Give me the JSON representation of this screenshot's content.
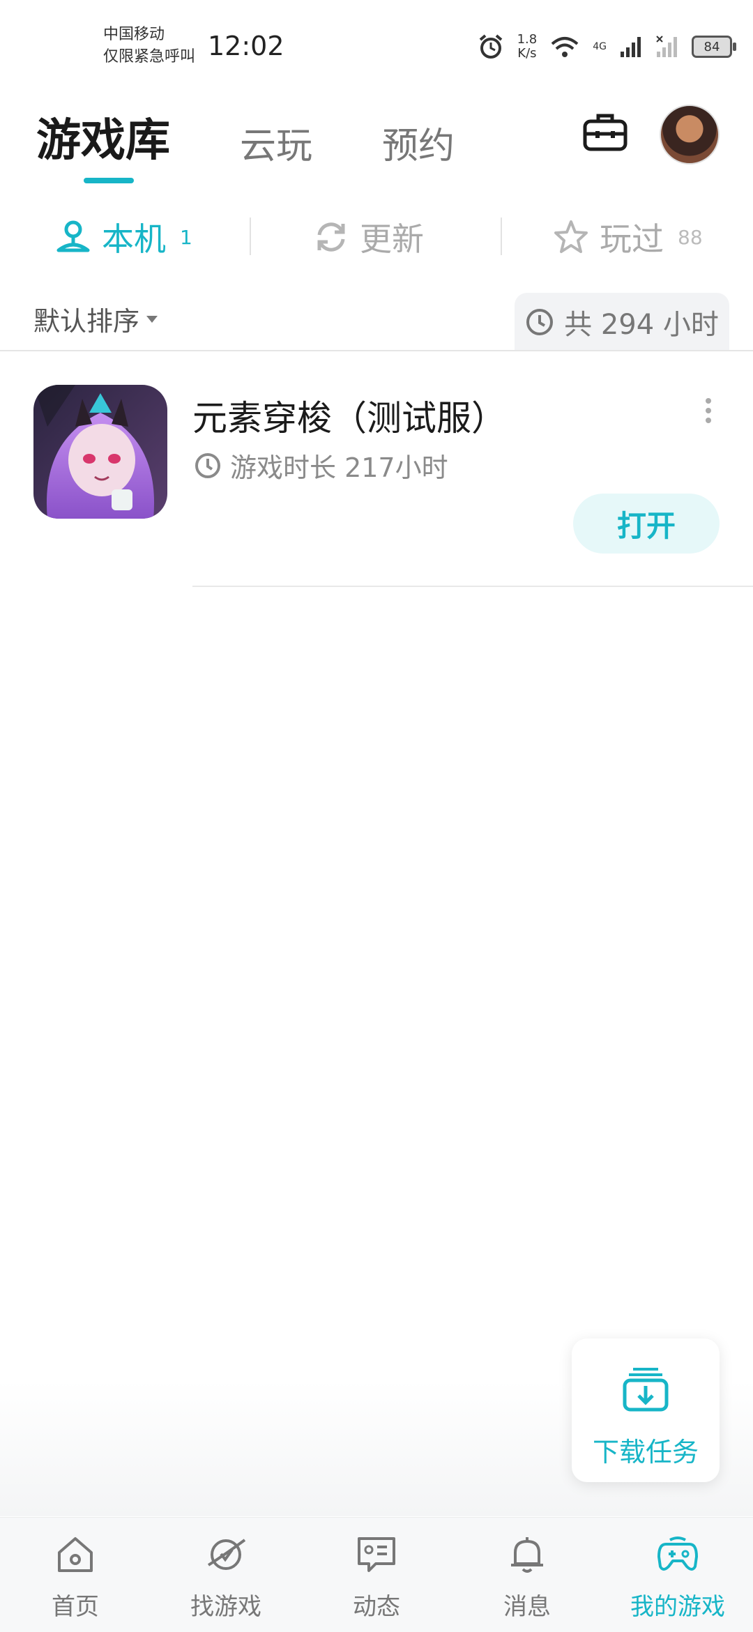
{
  "status_bar": {
    "carrier_line1": "中国移动",
    "carrier_line2": "仅限紧急呼叫",
    "time": "12:02",
    "net_speed_value": "1.8",
    "net_speed_unit": "K/s",
    "network_type": "4G",
    "battery": "84"
  },
  "header": {
    "tabs": [
      {
        "label": "游戏库",
        "active": true
      },
      {
        "label": "云玩",
        "active": false
      },
      {
        "label": "预约",
        "active": false
      }
    ],
    "toolbox_icon": "toolbox-icon",
    "avatar_icon": "avatar"
  },
  "subtabs": [
    {
      "label": "本机",
      "count": "1",
      "icon": "local-device-icon",
      "active": true
    },
    {
      "label": "更新",
      "count": "",
      "icon": "refresh-icon",
      "active": false
    },
    {
      "label": "玩过",
      "count": "88",
      "icon": "star-icon",
      "active": false
    }
  ],
  "sort": {
    "label": "默认排序",
    "total_playtime": "共 294 小时"
  },
  "games": [
    {
      "title": "元素穿梭（测试服）",
      "playtime": "游戏时长 217小时",
      "action": "打开"
    }
  ],
  "download_task": {
    "label": "下载任务"
  },
  "bottom_nav": [
    {
      "label": "首页",
      "icon": "home-icon",
      "active": false
    },
    {
      "label": "找游戏",
      "icon": "planet-icon",
      "active": false
    },
    {
      "label": "动态",
      "icon": "message-card-icon",
      "active": false
    },
    {
      "label": "消息",
      "icon": "bell-icon",
      "active": false
    },
    {
      "label": "我的游戏",
      "icon": "gamepad-icon",
      "active": true
    }
  ],
  "colors": {
    "accent": "#17b5c7",
    "text_primary": "#1b1b1b",
    "text_secondary": "#8a8a8a"
  }
}
